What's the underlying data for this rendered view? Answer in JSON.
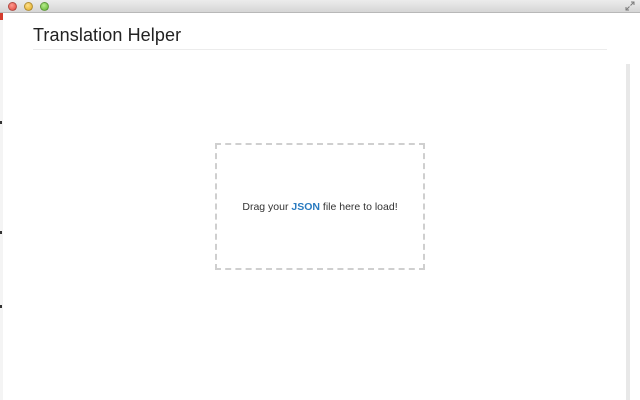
{
  "app": {
    "title": "Translation Helper"
  },
  "dropzone": {
    "prefix": "Drag your ",
    "highlight": "JSON",
    "suffix": " file here to load!"
  },
  "colors": {
    "accent": "#2a7bc0",
    "title_text": "#222222",
    "dropzone_border": "#cfcfcf"
  }
}
